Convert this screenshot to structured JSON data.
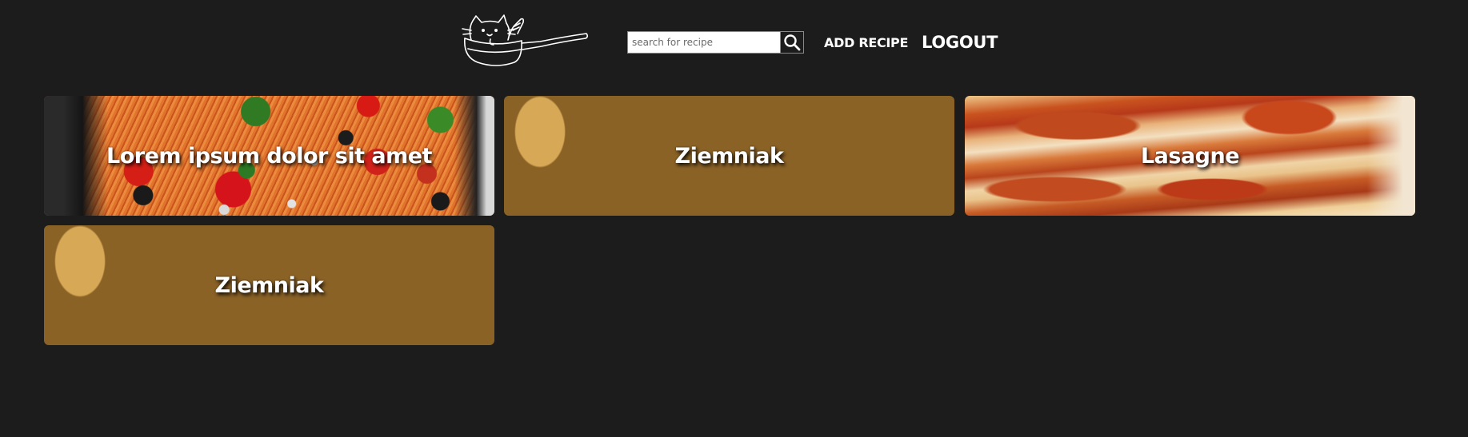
{
  "header": {
    "search_placeholder": "search for recipe",
    "add_recipe_label": "ADD RECIPE",
    "logout_label": "LOGOUT"
  },
  "recipes": [
    {
      "title": "Lorem ipsum dolor sit amet",
      "image": "pasta"
    },
    {
      "title": "Ziemniak",
      "image": "potatoes"
    },
    {
      "title": "Lasagne",
      "image": "lasagne"
    },
    {
      "title": "Ziemniak",
      "image": "potatoes"
    }
  ],
  "colors": {
    "background": "#1c1c1c",
    "text": "#ffffff"
  }
}
